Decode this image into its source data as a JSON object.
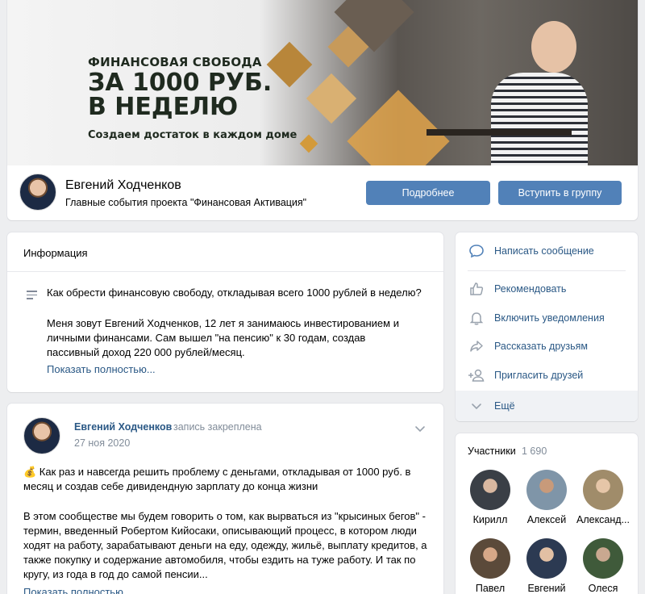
{
  "cover": {
    "line1": "ФИНАНСОВАЯ СВОБОДА",
    "line2": "ЗА 1000 РУБ.",
    "line3": "В НЕДЕЛЮ",
    "line4": "Создаем достаток в каждом доме"
  },
  "header": {
    "name": "Евгений Ходченков",
    "status": "Главные события проекта \"Финансовая Активация\"",
    "more_button": "Подробнее",
    "join_button": "Вступить в группу"
  },
  "info": {
    "title": "Информация",
    "question": "Как обрести финансовую свободу, откладывая всего 1000 рублей в неделю?",
    "paragraph": "Меня зовут Евгений Ходченков, 12 лет я занимаюсь инвестированием и личными финансами. Сам вышел \"на пенсию\" к 30 годам, создав пассивный доход 220 000 рублей/месяц.",
    "show_more": "Показать полностью..."
  },
  "post": {
    "author": "Евгений Ходченков",
    "pinned": "запись закреплена",
    "date": "27 ноя 2020",
    "text1": "💰 Как раз и навсегда решить проблему с деньгами, откладывая от 1000 руб. в месяц и создав себе дивидендную зарплату до конца жизни",
    "text2": "В этом сообществе мы будем говорить о том, как вырваться из \"крысиных бегов\" - термин, введенный Робертом Кийосаки, описывающий процесс, в котором люди ходят на работу, зарабатывают деньги на еду, одежду, жильё, выплату кредитов, а также покупку и содержание автомобиля, чтобы ездить на туже работу. И так по кругу, из года в год до самой пенсии...",
    "show_more": "Показать полностью..."
  },
  "actions": {
    "message": "Написать сообщение",
    "recommend": "Рекомендовать",
    "notify": "Включить уведомления",
    "tell": "Рассказать друзьям",
    "invite": "Пригласить друзей",
    "more": "Ещё"
  },
  "members": {
    "title": "Участники",
    "count": "1 690",
    "list": [
      {
        "name": "Кирилл",
        "color": "#3a3f46"
      },
      {
        "name": "Алексей",
        "color": "#7f95a8"
      },
      {
        "name": "Александ...",
        "color": "#a08c6a"
      },
      {
        "name": "Павел",
        "color": "#5b4a3a"
      },
      {
        "name": "Евгений",
        "color": "#2c3a52"
      },
      {
        "name": "Олеся",
        "color": "#3f5a3a"
      }
    ]
  },
  "colors": {
    "accent": "#5181b8",
    "link": "#2a5885",
    "background": "#edeef0"
  }
}
